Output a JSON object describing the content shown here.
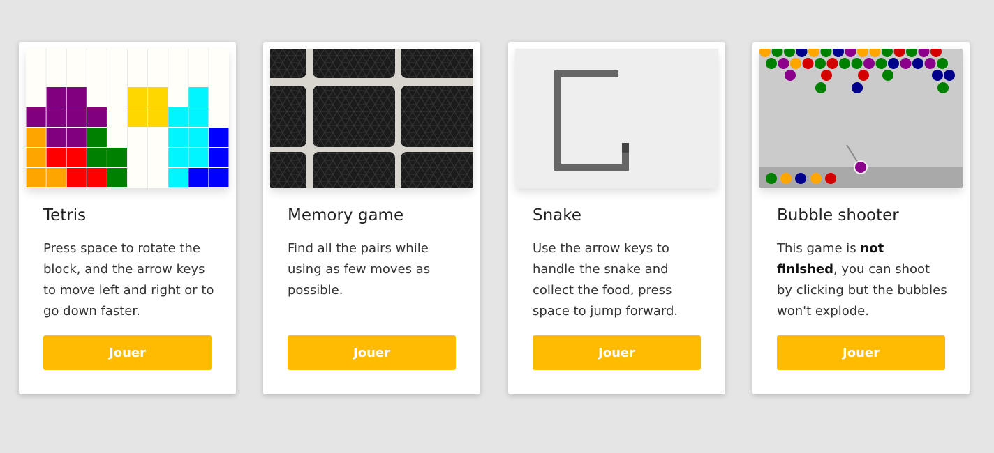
{
  "colors": {
    "accent": "#ffbb00",
    "background": "#e5e5e5",
    "card": "#ffffff"
  },
  "cards": [
    {
      "title": "Tetris",
      "description": "Press space to rotate the block, and the arrow keys to move left and right or to go down faster.",
      "button_label": "Jouer",
      "thumbnail": "tetris-board-image"
    },
    {
      "title": "Memory game",
      "description": "Find all the pairs while using as few moves as possible.",
      "button_label": "Jouer",
      "thumbnail": "memory-cards-image"
    },
    {
      "title": "Snake",
      "description": "Use the arrow keys to handle the snake and collect the food, press space to jump forward.",
      "button_label": "Jouer",
      "thumbnail": "snake-game-image"
    },
    {
      "title": "Bubble shooter",
      "description_before": "This game is ",
      "description_bold": "not finished",
      "description_after": ", you can shoot by clicking but the bubbles won't explode.",
      "button_label": "Jouer",
      "thumbnail": "bubble-shooter-image"
    }
  ]
}
